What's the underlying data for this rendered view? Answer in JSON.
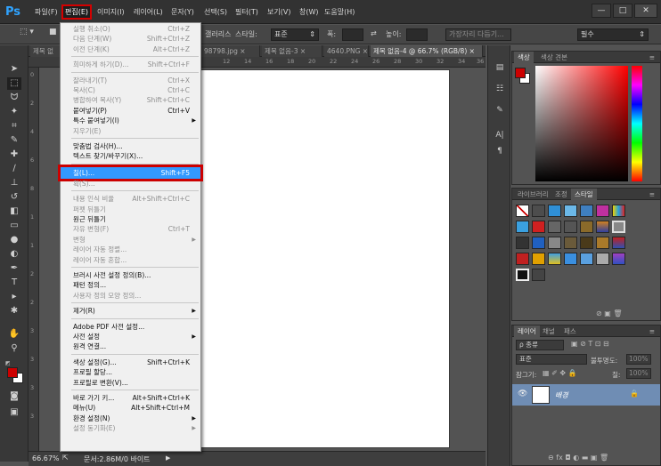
{
  "app": {
    "logo": "Ps"
  },
  "menubar": {
    "items": [
      "파일(F)",
      "편집(E)",
      "이미지(I)",
      "레이어(L)",
      "문자(Y)",
      "선택(S)",
      "필터(T)",
      "보기(V)",
      "창(W)",
      "도움말(H)"
    ],
    "window_controls": [
      "—",
      "□",
      "✕"
    ]
  },
  "options": {
    "gallery": "갤러리스",
    "style_label": "스타일:",
    "style_value": "표준",
    "width_label": "폭:",
    "height_label": "높이:",
    "refine_edge": "가장자리 다듬기...",
    "workspace": "필수"
  },
  "tabs": [
    {
      "label": "제목 없",
      "active": false
    },
    {
      "label": "98798.jpg",
      "active": false
    },
    {
      "label": "제목 없음-3",
      "active": false
    },
    {
      "label": "4640.PNG",
      "active": false
    },
    {
      "label": "제목 없음-4 @ 66.7% (RGB/8)",
      "active": true
    }
  ],
  "ruler_top": [
    "12",
    "14",
    "16",
    "18",
    "20",
    "22",
    "24",
    "26",
    "28",
    "30",
    "32",
    "34",
    "36"
  ],
  "ruler_left": [
    "0",
    "2",
    "4",
    "6",
    "8",
    "1",
    "1",
    "2",
    "2",
    "3",
    "3",
    "3",
    "3"
  ],
  "status": {
    "zoom": "66.67%",
    "doc": "문서:2.86M/0 바이트"
  },
  "panels": {
    "color_tabs": [
      "색상",
      "색상 견본"
    ],
    "library_tabs": [
      "라이브러리",
      "조정",
      "스타일"
    ],
    "layers_tabs": [
      "레이어",
      "채널",
      "패스"
    ],
    "layers_kind": "ρ 종류",
    "blend_mode": "표준",
    "opacity_label": "불투명도:",
    "opacity_value": "100%",
    "lock_label": "잠그기:",
    "fill_label": "칠:",
    "fill_value": "100%",
    "layer_name": "배경"
  },
  "edit_menu": [
    {
      "label": "실행 취소(O)",
      "shortcut": "Ctrl+Z",
      "disabled": true
    },
    {
      "label": "다음 단계(W)",
      "shortcut": "Shift+Ctrl+Z",
      "disabled": true
    },
    {
      "label": "이전 단계(K)",
      "shortcut": "Alt+Ctrl+Z",
      "disabled": true
    },
    {
      "sep": true
    },
    {
      "label": "희미하게 하기(D)...",
      "shortcut": "Shift+Ctrl+F",
      "disabled": true
    },
    {
      "sep": true
    },
    {
      "label": "잘라내기(T)",
      "shortcut": "Ctrl+X",
      "disabled": true
    },
    {
      "label": "복사(C)",
      "shortcut": "Ctrl+C",
      "disabled": true
    },
    {
      "label": "병합하여 복사(Y)",
      "shortcut": "Shift+Ctrl+C",
      "disabled": true
    },
    {
      "label": "붙여넣기(P)",
      "shortcut": "Ctrl+V",
      "disabled": false
    },
    {
      "label": "특수 붙여넣기(I)",
      "shortcut": "",
      "disabled": false,
      "submenu": true
    },
    {
      "label": "지우기(E)",
      "shortcut": "",
      "disabled": true
    },
    {
      "sep": true
    },
    {
      "label": "맞춤법 검사(H)...",
      "shortcut": "",
      "disabled": false
    },
    {
      "label": "텍스트 찾기/바꾸기(X)...",
      "shortcut": "",
      "disabled": false
    },
    {
      "sep": true
    },
    {
      "label": "칠(L)...",
      "shortcut": "Shift+F5",
      "disabled": false,
      "highlight": true
    },
    {
      "label": "획(S)...",
      "shortcut": "",
      "disabled": true
    },
    {
      "sep": true
    },
    {
      "label": "내용 인식 비율",
      "shortcut": "Alt+Shift+Ctrl+C",
      "disabled": true
    },
    {
      "label": "퍼펫 뒤틀기",
      "shortcut": "",
      "disabled": true
    },
    {
      "label": "원근 뒤틀기",
      "shortcut": "",
      "disabled": false
    },
    {
      "label": "자유 변형(F)",
      "shortcut": "Ctrl+T",
      "disabled": true
    },
    {
      "label": "변형",
      "shortcut": "",
      "disabled": true,
      "submenu": true
    },
    {
      "label": "레이어 자동 정렬...",
      "shortcut": "",
      "disabled": true
    },
    {
      "label": "레이어 자동 혼합...",
      "shortcut": "",
      "disabled": true
    },
    {
      "sep": true
    },
    {
      "label": "브러시 사전 설정 정의(B)...",
      "shortcut": "",
      "disabled": false
    },
    {
      "label": "패턴 정의...",
      "shortcut": "",
      "disabled": false
    },
    {
      "label": "사용자 정의 모양 정의...",
      "shortcut": "",
      "disabled": true
    },
    {
      "sep": true
    },
    {
      "label": "제거(R)",
      "shortcut": "",
      "disabled": false,
      "submenu": true
    },
    {
      "sep": true
    },
    {
      "label": "Adobe PDF 사전 설정...",
      "shortcut": "",
      "disabled": false
    },
    {
      "label": "사전 설정",
      "shortcut": "",
      "disabled": false,
      "submenu": true
    },
    {
      "label": "원격 연결...",
      "shortcut": "",
      "disabled": false
    },
    {
      "sep": true
    },
    {
      "label": "색상 설정(G)...",
      "shortcut": "Shift+Ctrl+K",
      "disabled": false
    },
    {
      "label": "프로필 할당...",
      "shortcut": "",
      "disabled": false
    },
    {
      "label": "프로필로 변환(V)...",
      "shortcut": "",
      "disabled": false
    },
    {
      "sep": true
    },
    {
      "label": "바로 가기 키...",
      "shortcut": "Alt+Shift+Ctrl+K",
      "disabled": false
    },
    {
      "label": "메뉴(U)",
      "shortcut": "Alt+Shift+Ctrl+M",
      "disabled": false
    },
    {
      "label": "환경 설정(N)",
      "shortcut": "",
      "disabled": false,
      "submenu": true
    },
    {
      "label": "설정 동기화(E)",
      "shortcut": "",
      "disabled": true,
      "submenu": true
    }
  ],
  "colors": {
    "foreground": "#cc0000",
    "background": "#ffffff",
    "accent": "#3399ff",
    "highlight_border": "#cc0000"
  }
}
